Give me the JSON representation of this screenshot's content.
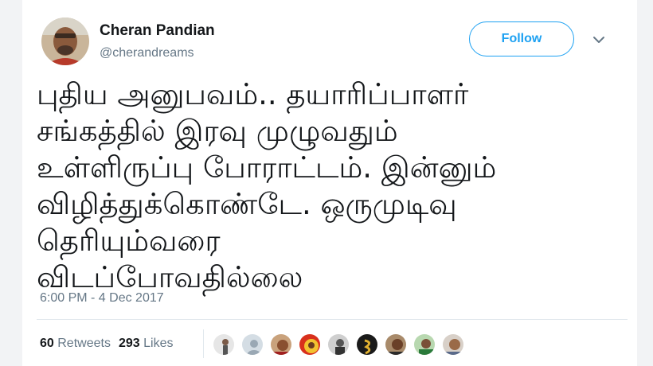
{
  "user": {
    "display_name": "Cheran Pandian",
    "handle": "@cherandreams",
    "avatar_icon": "profile-photo"
  },
  "follow": {
    "label": "Follow"
  },
  "menu": {
    "icon": "chevron-down-icon"
  },
  "tweet": {
    "lines": [
      "புதிய அனுபவம்.. தயாரிப்பாளர்",
      "சங்கத்தில் இரவு முழுவதும்",
      "உள்ளிருப்பு போராட்டம். இன்னும்",
      "விழித்துக்கொண்டே. ஒருமுடிவு",
      "தெரியும்வரை",
      "விடப்போவதில்லை"
    ],
    "timestamp": "6:00 PM - 4 Dec 2017"
  },
  "stats": {
    "retweets_count": "60",
    "retweets_label": "Retweets",
    "likes_count": "293",
    "likes_label": "Likes"
  },
  "colors": {
    "accent": "#1da1f2",
    "text": "#14171a",
    "muted": "#657786"
  }
}
